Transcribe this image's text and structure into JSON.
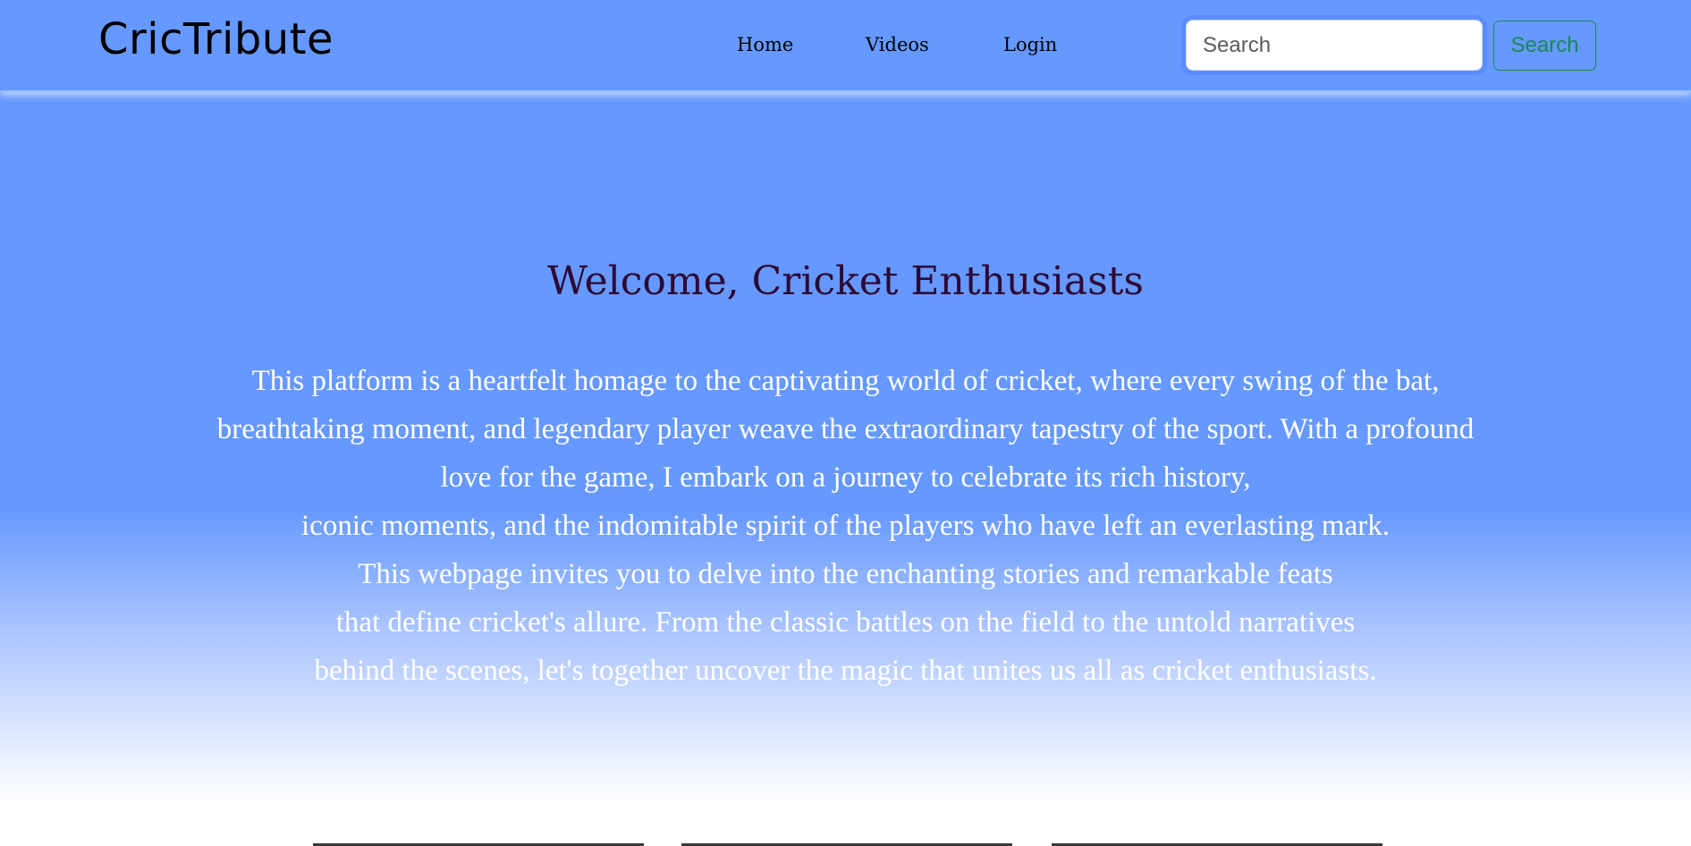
{
  "navbar": {
    "brand": "CricTribute",
    "links": [
      {
        "label": "Home"
      },
      {
        "label": "Videos"
      },
      {
        "label": "Login"
      }
    ],
    "search": {
      "placeholder": "Search",
      "button_label": "Search"
    }
  },
  "hero": {
    "title": "Welcome, Cricket Enthusiasts",
    "lines": [
      "This platform is a heartfelt homage to the captivating world of cricket, where every swing of the bat,",
      "breathtaking moment, and legendary player weave the extraordinary tapestry of the sport. With a profound",
      "love for the game, I embark on a journey to celebrate its rich history,",
      "iconic moments, and the indomitable spirit of the players who have left an everlasting mark.",
      "This webpage invites you to delve into the enchanting stories and remarkable feats",
      "that define cricket's allure. From the classic battles on the field to the untold narratives",
      "behind the scenes, let's together uncover the magic that unites us all as cricket enthusiasts."
    ]
  },
  "colors": {
    "background": "#6699ff",
    "title": "#2d0a35",
    "body_text": "#ffffff",
    "search_button": "#198754"
  }
}
